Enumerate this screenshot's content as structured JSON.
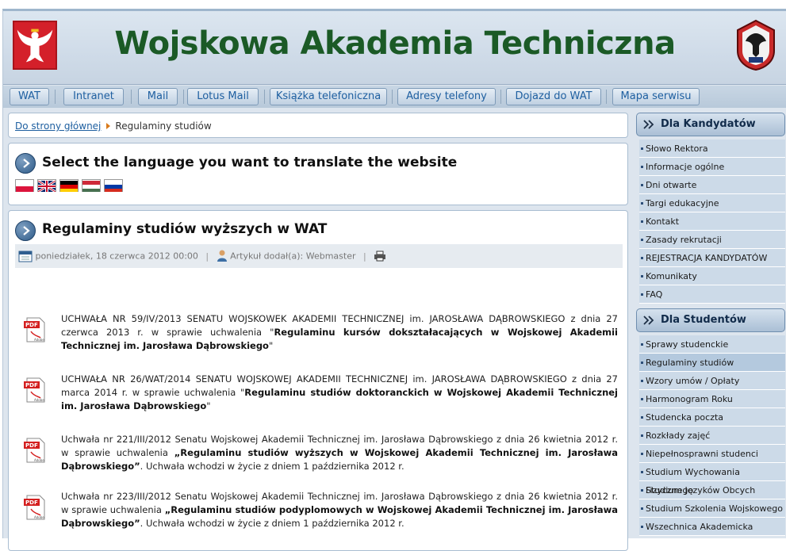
{
  "header": {
    "title": "Wojskowa Akademia Techniczna"
  },
  "nav": [
    {
      "label": "WAT"
    },
    {
      "label": "Intranet"
    },
    {
      "label": "Mail"
    },
    {
      "label": "Lotus Mail"
    },
    {
      "label": "Książka telefoniczna"
    },
    {
      "label": "Adresy telefony"
    },
    {
      "label": "Dojazd do WAT"
    },
    {
      "label": "Mapa serwisu"
    }
  ],
  "breadcrumb": {
    "home": "Do strony głównej",
    "current": "Regulaminy studiów"
  },
  "language": {
    "title": "Select the language you want to translate the website"
  },
  "article": {
    "title": "Regulaminy studiów wyższych w WAT",
    "date": "poniedziałek, 18 czerwca 2012 00:00",
    "author": "Artykuł dodał(a): Webmaster",
    "docs": [
      {
        "pre": "UCHWAŁA NR 59/IV/2013 SENATU WOJSKOWEK AKADEMII TECHNICZNEJ im. JAROSŁAWA DĄBROWSKIEGO z dnia 27 czerwca 2013 r. w sprawie uchwalenia \"",
        "bold": "Regulaminu kursów dokształacających w Wojskowej Akademii Technicznej im. Jarosława Dąbrowskiego",
        "post": "\""
      },
      {
        "pre": "UCHWAŁA NR 26/WAT/2014 SENATU WOJSKOWEJ AKADEMII TECHNICZNEJ im. JAROSŁAWA DĄBROWSKIEGO z dnia 27 marca 2014 r. w sprawie uchwalenia \"",
        "bold": "Regulaminu studiów doktoranckich w Wojskowej Akademii Technicznej im. Jarosława Dąbrowskiego",
        "post": "\""
      },
      {
        "pre": "Uchwała nr 221/III/2012 Senatu Wojskowej Akademii Technicznej im. Jarosława Dąbrowskiego z dnia 26 kwietnia 2012 r. w sprawie uchwalenia ",
        "bold": "„Regulaminu studiów wyższych w Wojskowej Akademii Technicznej im. Jarosława Dąbrowskiego”",
        "post": ". Uchwała wchodzi w życie z dniem 1 października 2012 r."
      },
      {
        "pre": "Uchwała nr 223/III/2012 Senatu Wojskowej Akademii Technicznej im. Jarosława Dąbrowskiego z dnia 26 kwietnia 2012 r. w sprawie uchwalenia ",
        "bold": "„Regulaminu studiów podyplomowych w Wojskowej Akademii Technicznej im. Jarosława Dąbrowskiego”",
        "post": ". Uchwała wchodzi w życie z dniem 1 października 2012 r."
      }
    ]
  },
  "sidebar": {
    "candidates": {
      "title": "Dla Kandydatów",
      "items": [
        "Słowo Rektora",
        "Informacje ogólne",
        "Dni otwarte",
        "Targi edukacyjne",
        "Kontakt",
        "Zasady rekrutacji",
        "REJESTRACJA KANDYDATÓW",
        "Komunikaty",
        "FAQ"
      ]
    },
    "students": {
      "title": "Dla Studentów",
      "items": [
        "Sprawy studenckie",
        "Regulaminy studiów",
        "Wzory umów / Opłaty",
        "Harmonogram Roku",
        "Studencka poczta",
        "Rozkłady zajęć",
        "Niepełnosprawni studenci",
        "Studium Wychowania Fizycznego",
        "Studium Języków Obcych",
        "Studium Szkolenia Wojskowego",
        "Wszechnica Akademicka"
      ],
      "active": "Regulaminy studiów"
    }
  },
  "icons": {
    "emblem": "polish-eagle-icon",
    "crest": "wat-crest-icon",
    "pdf": "pdf-icon",
    "calendar": "calendar-icon",
    "author": "user-icon",
    "print": "printer-icon"
  }
}
